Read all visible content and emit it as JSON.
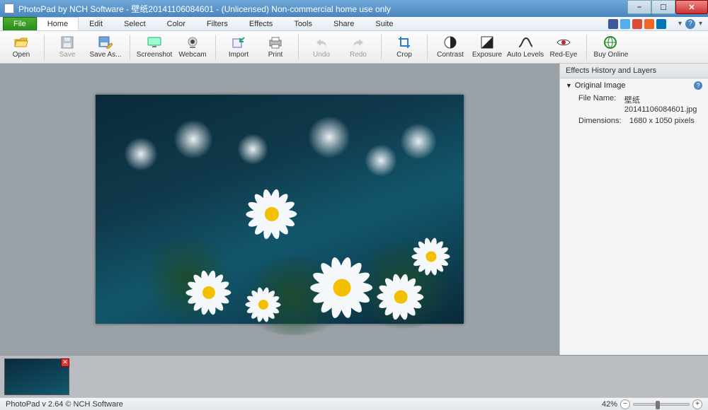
{
  "window": {
    "title": "PhotoPad by NCH Software - 壁纸20141106084601 - (Unlicensed) Non-commercial home use only"
  },
  "menu": {
    "file": "File",
    "tabs": [
      "Home",
      "Edit",
      "Select",
      "Color",
      "Filters",
      "Effects",
      "Tools",
      "Share",
      "Suite"
    ],
    "active_index": 0
  },
  "toolbar": {
    "open": "Open",
    "save": "Save",
    "saveas": "Save As...",
    "screenshot": "Screenshot",
    "webcam": "Webcam",
    "import": "Import",
    "print": "Print",
    "undo": "Undo",
    "redo": "Redo",
    "crop": "Crop",
    "contrast": "Contrast",
    "exposure": "Exposure",
    "autolevels": "Auto Levels",
    "redeye": "Red-Eye",
    "buyonline": "Buy Online"
  },
  "panel": {
    "title": "Effects History and Layers",
    "node": "Original Image",
    "filename_k": "File Name:",
    "filename_v": "壁纸20141106084601.jpg",
    "dim_k": "Dimensions:",
    "dim_v": "1680 x 1050 pixels"
  },
  "status": {
    "text": "PhotoPad v 2.64 © NCH Software",
    "zoom": "42%",
    "zoom_frac": 0.42
  },
  "icons": {
    "social": [
      "facebook",
      "twitter",
      "google-plus",
      "rss",
      "linkedin"
    ]
  }
}
